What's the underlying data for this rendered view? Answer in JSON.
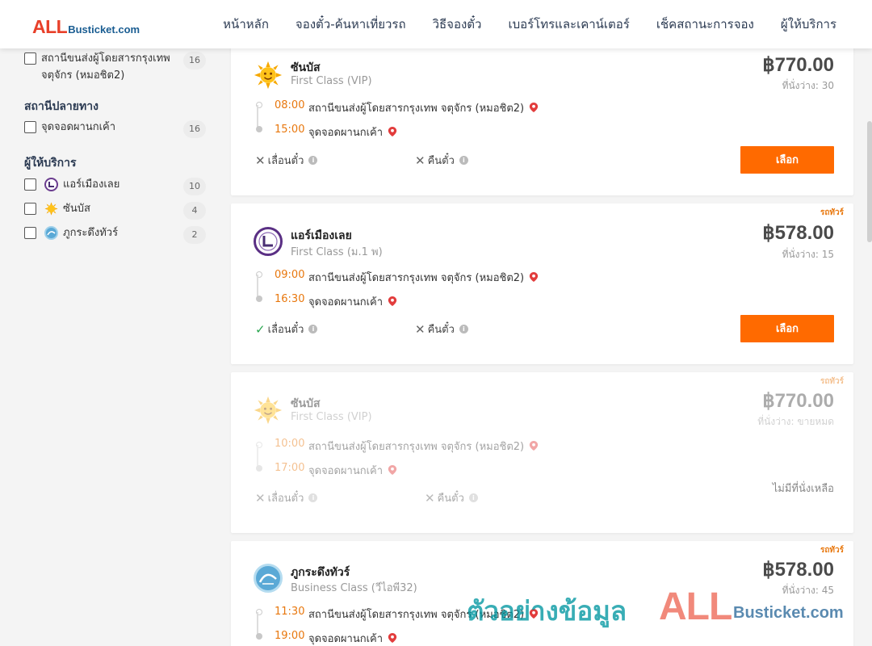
{
  "header": {
    "logo_main": "ALL",
    "logo_sub": "Busticket.com",
    "nav": [
      "หน้าหลัก",
      "จองตั๋ว-ค้นหาเที่ยวรถ",
      "วิธีจองตั๋ว",
      "เบอร์โทรและเคาน์เตอร์",
      "เช็คสถานะการจอง",
      "ผู้ให้บริการ"
    ]
  },
  "sidebar": {
    "origin_items": [
      {
        "label": "สถานีขนส่งผู้โดยสารกรุงเทพ จตุจักร (หมอชิต2)",
        "count": "16"
      }
    ],
    "destination_title": "สถานีปลายทาง",
    "destination_items": [
      {
        "label": "จุดจอดผานกเค้า",
        "count": "16"
      }
    ],
    "operator_title": "ผู้ให้บริการ",
    "operator_items": [
      {
        "label": "แอร์เมืองเลย",
        "count": "10",
        "icon": "air-muang-loei-logo-icon"
      },
      {
        "label": "ซันบัส",
        "count": "4",
        "icon": "sun-logo-icon"
      },
      {
        "label": "ภูกระดึงทัวร์",
        "count": "2",
        "icon": "phukradueng-logo-icon"
      }
    ]
  },
  "labels": {
    "change": "เลื่อนตั๋ว",
    "refund": "คืนตั๋ว",
    "select": "เลือก",
    "no_seats": "ไม่มีที่นั่งเหลือ",
    "seats_prefix": "ที่นั่งว่าง:",
    "tour_tag": "รถทัวร์"
  },
  "trips": [
    {
      "operator": "ซันบัส",
      "class": "First Class (VIP)",
      "price": "฿770.00",
      "seats": "ที่นั่งว่าง: 30",
      "depart_time": "08:00",
      "depart_place": "สถานีขนส่งผู้โดยสารกรุงเทพ จตุจักร (หมอชิต2)",
      "arrive_time": "15:00",
      "arrive_place": "จุดจอดผานกเค้า",
      "change_allowed": false,
      "refund_allowed": false,
      "available": true,
      "tag": ""
    },
    {
      "operator": "แอร์เมืองเลย",
      "class": "First Class (ม.1 พ)",
      "price": "฿578.00",
      "seats": "ที่นั่งว่าง: 15",
      "depart_time": "09:00",
      "depart_place": "สถานีขนส่งผู้โดยสารกรุงเทพ จตุจักร (หมอชิต2)",
      "arrive_time": "16:30",
      "arrive_place": "จุดจอดผานกเค้า",
      "change_allowed": true,
      "refund_allowed": false,
      "available": true,
      "tag": "รถทัวร์"
    },
    {
      "operator": "ซันบัส",
      "class": "First Class (VIP)",
      "price": "฿770.00",
      "seats": "ที่นั่งว่าง: ขายหมด",
      "depart_time": "10:00",
      "depart_place": "สถานีขนส่งผู้โดยสารกรุงเทพ จตุจักร (หมอชิต2)",
      "arrive_time": "17:00",
      "arrive_place": "จุดจอดผานกเค้า",
      "change_allowed": false,
      "refund_allowed": false,
      "available": false,
      "tag": "รถทัวร์"
    },
    {
      "operator": "ภูกระดึงทัวร์",
      "class": "Business Class (วีไอพี32)",
      "price": "฿578.00",
      "seats": "ที่นั่งว่าง: 45",
      "depart_time": "11:30",
      "depart_place": "สถานีขนส่งผู้โดยสารกรุงเทพ จตุจักร (หมอชิต2)",
      "arrive_time": "19:00",
      "arrive_place": "จุดจอดผานกเค้า",
      "change_allowed": false,
      "refund_allowed": false,
      "available": true,
      "tag": "รถทัวร์"
    }
  ],
  "watermark": {
    "text": "ตัวอย่างข้อมูล",
    "brand_main": "ALL",
    "brand_sub": "Busticket.com"
  },
  "colors": {
    "brand_red": "#e8402a",
    "brand_blue": "#1a5d92",
    "accent_orange": "#ff6a00",
    "time_orange": "#e8770d",
    "ok_green": "#2aa64f"
  }
}
